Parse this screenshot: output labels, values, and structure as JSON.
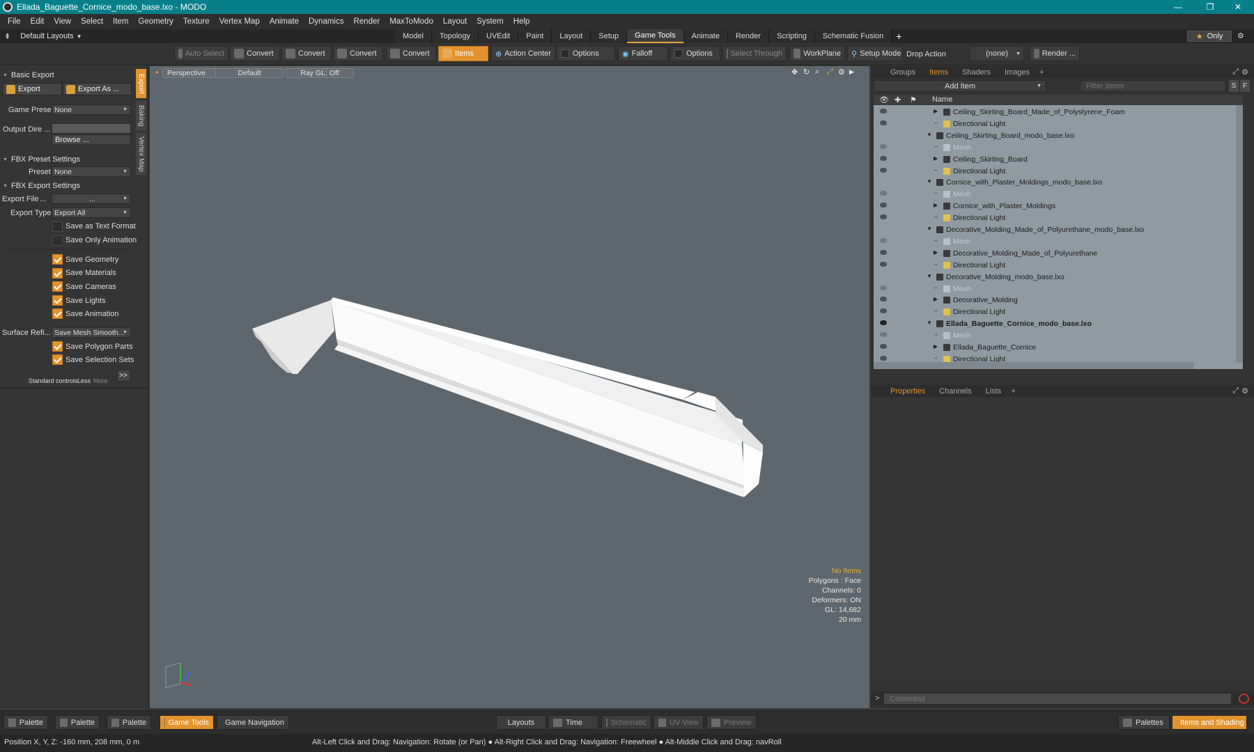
{
  "window": {
    "title": "Ellada_Baguette_Cornice_modo_base.lxo - MODO"
  },
  "menu": [
    "File",
    "Edit",
    "View",
    "Select",
    "Item",
    "Geometry",
    "Texture",
    "Vertex Map",
    "Animate",
    "Dynamics",
    "Render",
    "MaxToModo",
    "Layout",
    "System",
    "Help"
  ],
  "layout_tabs": {
    "layouts_label": "Default Layouts",
    "tabs": [
      "Model",
      "Topology",
      "UVEdit",
      "Paint",
      "Layout",
      "Setup",
      "Game Tools",
      "Animate",
      "Render",
      "Scripting",
      "Schematic Fusion"
    ],
    "active": "Game Tools",
    "only_label": "Only"
  },
  "toolbar": {
    "auto_select": "Auto Select",
    "convert1": "Convert",
    "convert2": "Convert",
    "convert3": "Convert",
    "convert4": "Convert",
    "items": "Items",
    "action_center": "Action Center",
    "options1": "Options",
    "falloff": "Falloff",
    "options2": "Options",
    "select_through": "Select Through",
    "workplane": "WorkPlane",
    "setup_mode": "Setup Mode",
    "drop_action": "Drop Action",
    "drop_value": "(none)",
    "render": "Render ..."
  },
  "left_panel": {
    "side_tabs": [
      "Export",
      "Baking",
      "Vertex Map"
    ],
    "basic_export": "Basic Export",
    "export_btn": "Export",
    "export_as_btn": "Export As ...",
    "game_preset_label": "Game Preset",
    "game_preset_value": "None",
    "output_dir_label": "Output Dire ...",
    "browse": "Browse ...",
    "fbx_preset_settings": "FBX Preset Settings",
    "preset_label": "Preset",
    "preset_value": "None",
    "fbx_export_settings": "FBX Export Settings",
    "export_file_label": "Export File",
    "export_file_dots": "...",
    "export_file_value": "...",
    "export_type_label": "Export Type",
    "export_type_value": "Export All",
    "save_text": "Save as Text Format",
    "save_only_anim": "Save Only Animation",
    "save_geometry": "Save Geometry",
    "save_materials": "Save Materials",
    "save_cameras": "Save Cameras",
    "save_lights": "Save Lights",
    "save_animation": "Save Animation",
    "surface_label": "Surface Refi...",
    "surface_value": "Save Mesh Smooth...",
    "save_polygon_parts": "Save Polygon Parts",
    "save_selection_sets": "Save Selection Sets",
    "standard_controls": "Standard controls",
    "less": "Less",
    "more": "More",
    "expand": ">>"
  },
  "viewport": {
    "view": "Perspective",
    "shading": "Default",
    "raygl": "Ray GL: Off",
    "info": {
      "no_items": "No Items",
      "polygons": "Polygons : Face",
      "channels": "Channels: 0",
      "deformers": "Deformers: ON",
      "gl": "GL: 14,682",
      "scale": "20 mm"
    }
  },
  "right_panel": {
    "tabs": [
      "Groups",
      "Items",
      "Shaders",
      "Images"
    ],
    "active_tab": "Items",
    "add_item": "Add Item",
    "filter_placeholder": "Filter Items",
    "s_btn": "S",
    "f_btn": "F",
    "name_col": "Name",
    "rows": [
      {
        "label": "Ceiling_Skirting_Board_Made_of_Polystyrene_Foam",
        "type": "group"
      },
      {
        "label": "Directional Light",
        "type": "light"
      },
      {
        "label": "Ceiling_Skirting_Board_modo_base.lxo",
        "type": "scene"
      },
      {
        "label": "Mesh",
        "type": "mesh"
      },
      {
        "label": "Ceiling_Skirting_Board",
        "type": "group"
      },
      {
        "label": "Directional Light",
        "type": "light"
      },
      {
        "label": "Cornice_with_Plaster_Moldings_modo_base.lxo",
        "type": "scene"
      },
      {
        "label": "Mesh",
        "type": "mesh"
      },
      {
        "label": "Cornice_with_Plaster_Moldings",
        "type": "group"
      },
      {
        "label": "Directional Light",
        "type": "light"
      },
      {
        "label": "Decorative_Molding_Made_of_Polyurethane_modo_base.lxo",
        "type": "scene"
      },
      {
        "label": "Mesh",
        "type": "mesh"
      },
      {
        "label": "Decorative_Molding_Made_of_Polyurethane",
        "type": "group"
      },
      {
        "label": "Directional Light",
        "type": "light"
      },
      {
        "label": "Decorative_Molding_modo_base.lxo",
        "type": "scene"
      },
      {
        "label": "Mesh",
        "type": "mesh"
      },
      {
        "label": "Decorative_Molding",
        "type": "group"
      },
      {
        "label": "Directional Light",
        "type": "light"
      },
      {
        "label": "Ellada_Baguette_Cornice_modo_base.lxo",
        "type": "scene-active"
      },
      {
        "label": "Mesh",
        "type": "mesh"
      },
      {
        "label": "Ellada_Baguette_Cornice",
        "type": "group"
      },
      {
        "label": "Directional Light",
        "type": "light"
      }
    ],
    "prop_tabs": [
      "Properties",
      "Channels",
      "Lists"
    ],
    "active_prop_tab": "Properties",
    "command_placeholder": "Command"
  },
  "bottom": {
    "palette1": "Palette",
    "palette2": "Palette",
    "palette3": "Palette",
    "game_tools": "Game Tools",
    "game_navigation": "Game Navigation",
    "layouts": "Layouts",
    "time": "Time",
    "schematic": "Schematic",
    "uv_view": "UV View",
    "preview": "Preview",
    "palettes": "Palettes",
    "items_shading": "Items and Shading"
  },
  "status": {
    "position": "Position X, Y, Z:  -160 mm, 208 mm, 0 m",
    "hint1": "Alt-Left Click and Drag: Navigation: Rotate (or Pan)",
    "hint2": "Alt-Right Click and Drag: Navigation: Freewheel",
    "hint3": "Alt-Middle Click and Drag: navRoll"
  },
  "colors": {
    "accent": "#e3932d",
    "titlebar": "#07808a",
    "viewport": "#5e676d"
  }
}
